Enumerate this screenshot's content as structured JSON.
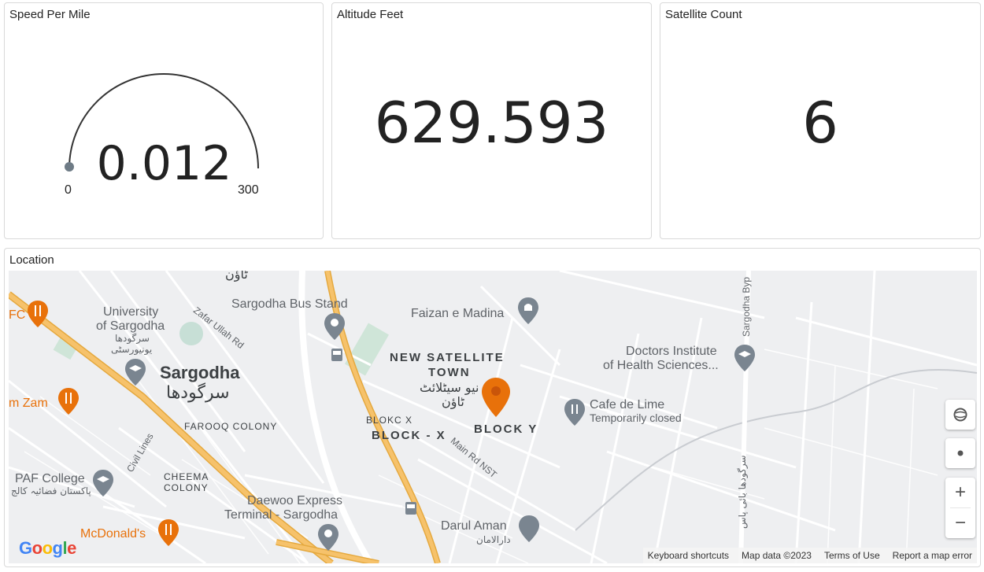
{
  "panels": {
    "speed": {
      "title": "Speed Per Mile",
      "value": "0.012",
      "min": "0",
      "max": "300",
      "fraction": 4e-05
    },
    "altitude": {
      "title": "Altitude Feet",
      "value": "629.593"
    },
    "satellites": {
      "title": "Satellite Count",
      "value": "6"
    },
    "location": {
      "title": "Location"
    }
  },
  "map": {
    "labels": {
      "urdu_town_top": "ٹاؤن",
      "bus_stand": "Sargodha Bus Stand",
      "faizan": "Faizan e Madina",
      "university_1": "University",
      "university_2": "of Sargodha",
      "university_urdu_1": "سرگودھا",
      "university_urdu_2": "یونیورسٹی",
      "zafar": "Zafar Ullah Rd",
      "kfc": "FC",
      "sargodha_en": "Sargodha",
      "sargodha_ur": "سرگودھا",
      "new_satellite_1": "NEW SATELLITE",
      "new_satellite_2": "TOWN",
      "new_satellite_ur_1": "نیو سیٹلائٹ",
      "new_satellite_ur_2": "ٹاؤن",
      "doctors_1": "Doctors Institute",
      "doctors_2": "of Health Sciences...",
      "bypass": "Sargodha Byp",
      "zam": "m Zam",
      "cafe": "Cafe de Lime",
      "cafe_status": "Temporarily closed",
      "blokc": "BLOKC X",
      "block_x": "BLOCK - X",
      "block_y": "BLOCK Y",
      "farooq": "FAROOQ COLONY",
      "civil": "Civil Lines",
      "main_rd": "Main Rd NST",
      "paf": "PAF College",
      "paf_ur": "پاکستان فضائیہ کالج",
      "cheema_1": "CHEEMA",
      "cheema_2": "COLONY",
      "daewoo_1": "Daewoo Express",
      "daewoo_2": "Terminal - Sargodha",
      "bypass_ur": "سرگودھا بائی پاس",
      "darul": "Darul Aman",
      "darul_ur": "دارالامان",
      "mcd": "McDonald's"
    },
    "attribution": {
      "shortcuts": "Keyboard shortcuts",
      "mapdata": "Map data ©2023",
      "terms": "Terms of Use",
      "report": "Report a map error"
    },
    "logo": "Google",
    "zoom_in": "+",
    "zoom_out": "−",
    "colors": {
      "highway": "#f6c26b",
      "highway_edge": "#e5a93f",
      "road": "#ffffff",
      "pin_marker": "#e8710a",
      "poi_pin": "#7a8590"
    }
  }
}
